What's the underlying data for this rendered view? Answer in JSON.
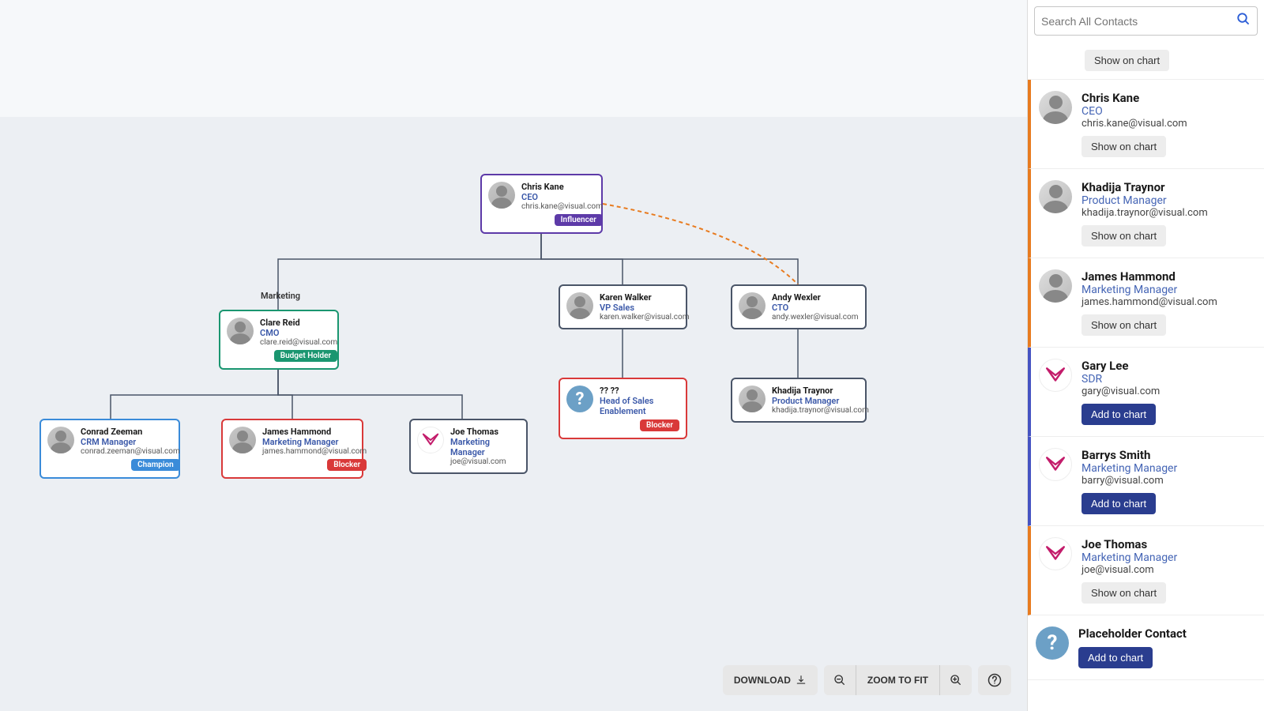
{
  "search": {
    "placeholder": "Search All Contacts"
  },
  "toolbar": {
    "download": "DOWNLOAD",
    "zoom_fit": "ZOOM TO FIT"
  },
  "dept": {
    "marketing": "Marketing"
  },
  "nodes": {
    "root": {
      "name": "Chris Kane",
      "title": "CEO",
      "email": "chris.kane@visual.com",
      "badge": "Influencer"
    },
    "clare": {
      "name": "Clare Reid",
      "title": "CMO",
      "email": "clare.reid@visual.com",
      "badge": "Budget Holder"
    },
    "karen": {
      "name": "Karen Walker",
      "title": "VP Sales",
      "email": "karen.walker@visual.com"
    },
    "andy": {
      "name": "Andy Wexler",
      "title": "CTO",
      "email": "andy.wexler@visual.com"
    },
    "conrad": {
      "name": "Conrad Zeeman",
      "title": "CRM Manager",
      "email": "conrad.zeeman@visual.com",
      "badge": "Champion"
    },
    "james": {
      "name": "James Hammond",
      "title": "Marketing Manager",
      "email": "james.hammond@visual.com",
      "badge": "Blocker"
    },
    "joe": {
      "name": "Joe Thomas",
      "title": "Marketing Manager",
      "email": "joe@visual.com"
    },
    "unknown": {
      "name": "?? ??",
      "title": "Head of Sales Enablement",
      "badge": "Blocker"
    },
    "khadija": {
      "name": "Khadija Traynor",
      "title": "Product Manager",
      "email": "khadija.traynor@visual.com"
    }
  },
  "sidebar": {
    "show_label": "Show on chart",
    "add_label": "Add to chart",
    "contacts": [
      {
        "name": "Chris Kane",
        "title": "CEO",
        "email": "chris.kane@visual.com",
        "accent": "orange",
        "action": "show",
        "avatar": "photo"
      },
      {
        "name": "Khadija Traynor",
        "title": "Product Manager",
        "email": "khadija.traynor@visual.com",
        "accent": "orange",
        "action": "show",
        "avatar": "photo"
      },
      {
        "name": "James Hammond",
        "title": "Marketing Manager",
        "email": "james.hammond@visual.com",
        "accent": "orange",
        "action": "show",
        "avatar": "photo"
      },
      {
        "name": "Gary Lee",
        "title": "SDR",
        "email": "gary@visual.com",
        "accent": "blue",
        "action": "add",
        "avatar": "logo"
      },
      {
        "name": "Barrys Smith",
        "title": "Marketing Manager",
        "email": "barry@visual.com",
        "accent": "blue",
        "action": "add",
        "avatar": "logo"
      },
      {
        "name": "Joe Thomas",
        "title": "Marketing Manager",
        "email": "joe@visual.com",
        "accent": "orange",
        "action": "show",
        "avatar": "logo"
      },
      {
        "name": "Placeholder Contact",
        "title": "",
        "email": "",
        "accent": "none",
        "action": "add",
        "avatar": "placeholder"
      }
    ]
  }
}
